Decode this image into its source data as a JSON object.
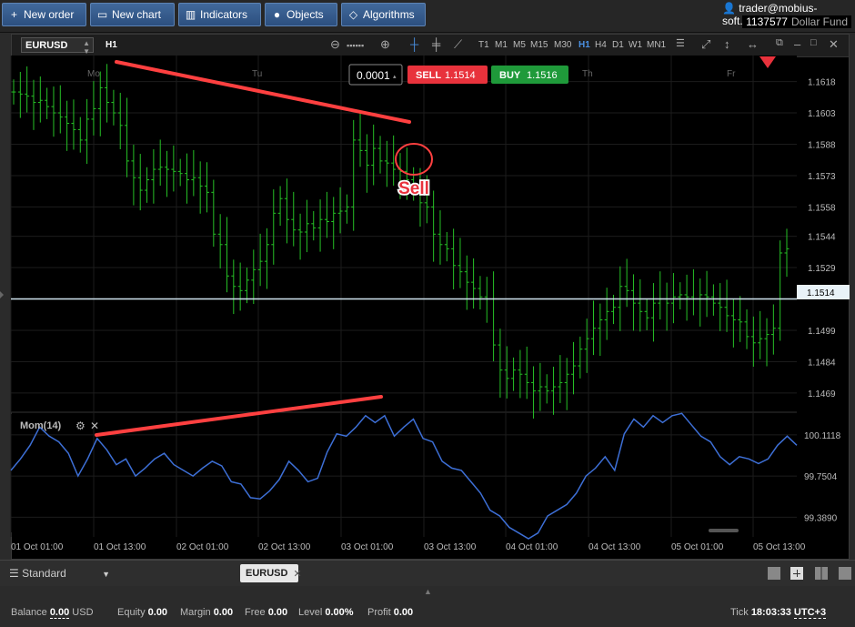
{
  "toolbar": {
    "new_order": "New order",
    "new_chart": "New chart",
    "indicators": "Indicators",
    "objects": "Objects",
    "algorithms": "Algorithms"
  },
  "account": {
    "user": "trader@mobius-soft.org",
    "number": "1137577",
    "fund": "Dollar Fund"
  },
  "chart_toolbar": {
    "symbol": "EURUSD",
    "timeframe": "H1",
    "timeframes": [
      "T1",
      "M1",
      "M5",
      "M15",
      "M30",
      "H1",
      "H4",
      "D1",
      "W1",
      "MN1"
    ],
    "active_timeframe": "H1"
  },
  "trade_panel": {
    "quantity": "0.0001",
    "sell_label": "SELL",
    "sell_price": "1.1514",
    "buy_label": "BUY",
    "buy_price": "1.1516"
  },
  "annotation": {
    "sell_text": "Sell"
  },
  "indicator": {
    "name": "Mom(14)"
  },
  "price_axis": {
    "ticks": [
      "1.1618",
      "1.1603",
      "1.1588",
      "1.1573",
      "1.1558",
      "1.1544",
      "1.1529",
      "1.1499",
      "1.1484",
      "1.1469"
    ],
    "current": "1.1514"
  },
  "momentum_axis": {
    "ticks": [
      "100.1118",
      "99.7504",
      "99.3890"
    ]
  },
  "day_labels": [
    "Mo",
    "Tu",
    "Th",
    "Fr"
  ],
  "time_labels": [
    "01 Oct 01:00",
    "01 Oct 13:00",
    "02 Oct 01:00",
    "02 Oct 13:00",
    "03 Oct 01:00",
    "03 Oct 13:00",
    "04 Oct 01:00",
    "04 Oct 13:00",
    "05 Oct 01:00",
    "05 Oct 13:00"
  ],
  "colors": {
    "candle": "#26c126",
    "momentum": "#3d6fd6",
    "trendline": "#ff3b3b",
    "sell": "#e8323c",
    "buy": "#1f9a3a"
  },
  "chart_data": {
    "type": "line",
    "series": [
      {
        "close": [
          1.1613,
          1.1612,
          1.1611,
          1.1608,
          1.1609,
          1.1606,
          1.1603,
          1.1601,
          1.1598,
          1.1595,
          1.159,
          1.16,
          1.1605,
          1.1615,
          1.1608,
          1.1603,
          1.1597,
          1.158,
          1.1572,
          1.1566,
          1.1571,
          1.1576,
          1.1577,
          1.1576,
          1.1575,
          1.1574,
          1.1571,
          1.1572,
          1.1568,
          1.1565,
          1.1545,
          1.154,
          1.1525,
          1.152,
          1.1518,
          1.1523,
          1.1528,
          1.1532,
          1.154,
          1.1555,
          1.1562,
          1.1552,
          1.1547,
          1.1546,
          1.155,
          1.1548,
          1.1552,
          1.1551,
          1.1555,
          1.1556,
          1.1558,
          1.159,
          1.1585,
          1.1578,
          1.1586,
          1.158,
          1.1579,
          1.1576,
          1.1575,
          1.1571,
          1.1567,
          1.156,
          1.1558,
          1.1545,
          1.154,
          1.1538,
          1.153,
          1.1527,
          1.1522,
          1.1519,
          1.1515,
          1.1514,
          1.1492,
          1.148,
          1.1476,
          1.148,
          1.1478,
          1.1474,
          1.147,
          1.1472,
          1.147,
          1.1472,
          1.1474,
          1.1478,
          1.1482,
          1.149,
          1.1495,
          1.15,
          1.1504,
          1.1508,
          1.151,
          1.152,
          1.1518,
          1.1512,
          1.1508,
          1.1505,
          1.1512,
          1.1514,
          1.1512,
          1.1515,
          1.1516,
          1.1515,
          1.1514,
          1.1516,
          1.1515,
          1.1512,
          1.151,
          1.1506,
          1.1504,
          1.1503,
          1.1496,
          1.1493,
          1.1495,
          1.1497,
          1.15,
          1.1536,
          1.1538
        ]
      },
      {
        "name": "Mom(14)",
        "values": [
          99.8,
          99.9,
          100.02,
          100.18,
          100.1,
          100.05,
          99.95,
          99.75,
          99.9,
          100.08,
          99.98,
          99.85,
          99.9,
          99.75,
          99.82,
          99.9,
          99.95,
          99.85,
          99.8,
          99.75,
          99.82,
          99.88,
          99.84,
          99.7,
          99.68,
          99.56,
          99.55,
          99.62,
          99.72,
          99.88,
          99.8,
          99.7,
          99.73,
          99.96,
          100.12,
          100.1,
          100.18,
          100.28,
          100.22,
          100.28,
          100.1,
          100.18,
          100.25,
          100.08,
          100.05,
          99.88,
          99.82,
          99.8,
          99.7,
          99.6,
          99.45,
          99.4,
          99.3,
          99.25,
          99.2,
          99.25,
          99.4,
          99.45,
          99.5,
          99.6,
          99.75,
          99.82,
          99.92,
          99.8,
          100.12,
          100.25,
          100.18,
          100.28,
          100.22,
          100.28,
          100.3,
          100.2,
          100.1,
          100.05,
          99.92,
          99.85,
          99.92,
          99.9,
          99.86,
          99.9,
          100.02,
          100.1,
          100.02
        ]
      }
    ],
    "y_range_price": [
      1.1462,
      1.163
    ],
    "y_range_momentum": [
      99.2,
      100.35
    ],
    "current_price": 1.1514,
    "grid": true
  }
}
